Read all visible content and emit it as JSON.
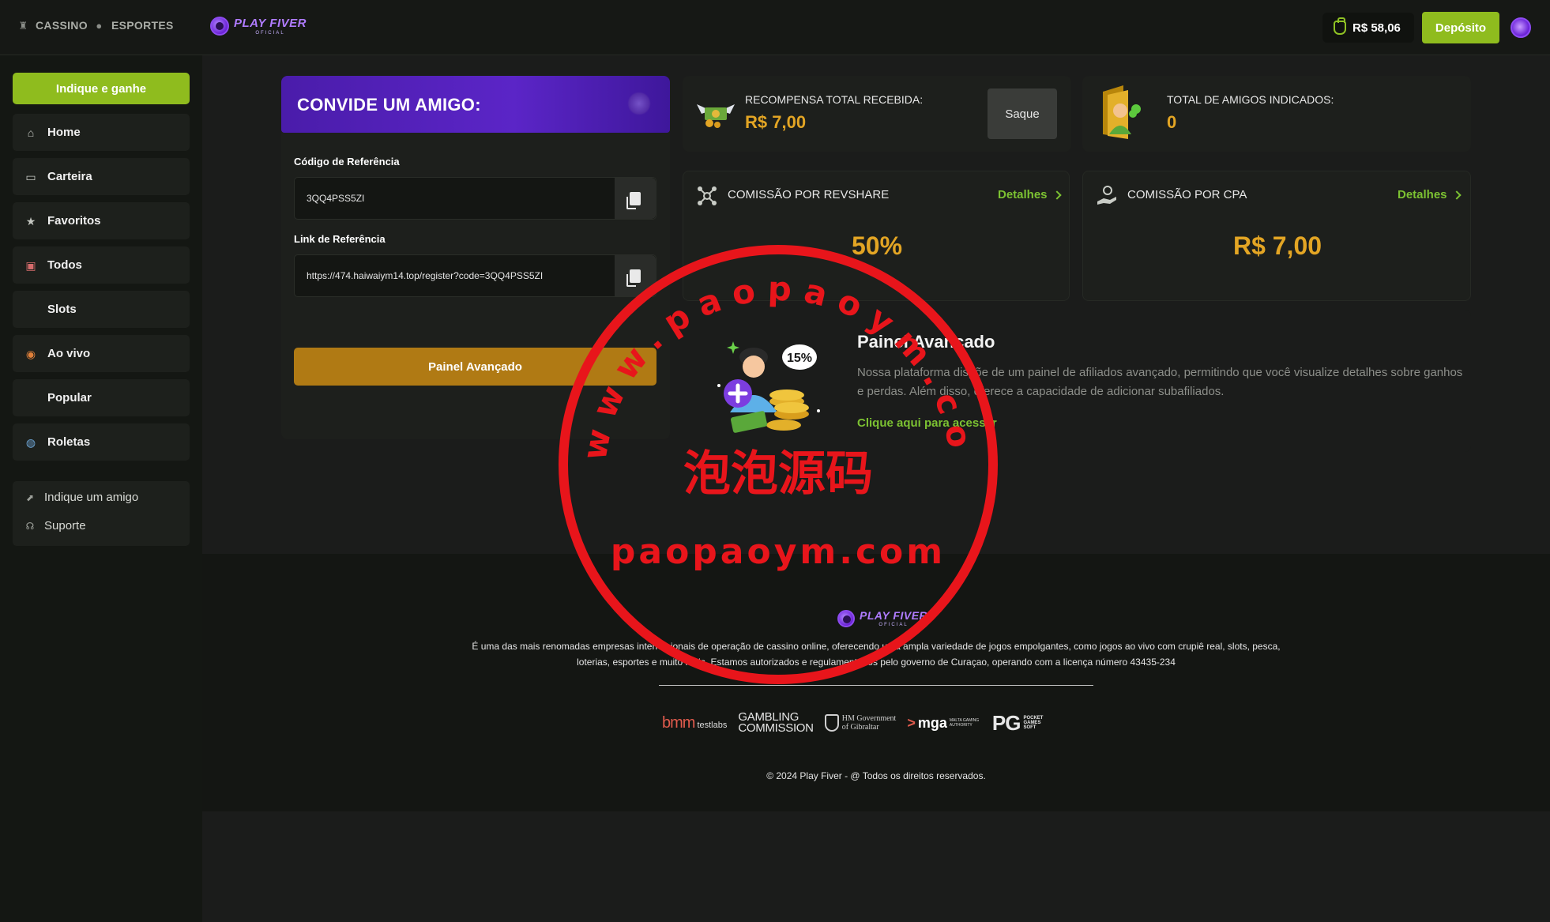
{
  "header": {
    "categories": [
      {
        "label": "CASSINO",
        "icon": "casino-icon"
      },
      {
        "label": "ESPORTES",
        "icon": "sports-ball-icon"
      }
    ],
    "logo": {
      "name": "PLAY FIVER",
      "tagline": "OFICIAL"
    },
    "balance": "R$ 58,06",
    "deposit_label": "Depósito"
  },
  "sidebar": {
    "cta_label": "Indique e ganhe",
    "items": [
      {
        "label": "Home",
        "icon": "home-icon"
      },
      {
        "label": "Carteira",
        "icon": "wallet-icon"
      },
      {
        "label": "Favoritos",
        "icon": "star-icon"
      },
      {
        "label": "Todos",
        "icon": "cake-icon"
      },
      {
        "label": "Slots",
        "icon": ""
      },
      {
        "label": "Ao vivo",
        "icon": "live-icon"
      },
      {
        "label": "Popular",
        "icon": ""
      },
      {
        "label": "Roletas",
        "icon": "roulette-icon"
      }
    ],
    "links": [
      {
        "label": "Indique um amigo",
        "icon": "share-icon"
      },
      {
        "label": "Suporte",
        "icon": "headset-icon"
      }
    ]
  },
  "invite": {
    "title": "CONVIDE UM AMIGO:",
    "code_label": "Código de Referência",
    "code_value": "3QQ4PSS5ZI",
    "link_label": "Link de Referência",
    "link_value": "https://474.haiwaiym14.top/register?code=3QQ4PSS5ZI",
    "advanced_button": "Painel Avançado"
  },
  "rewards": {
    "total_label": "RECOMPENSA TOTAL RECEBIDA:",
    "total_value": "R$ 7,00",
    "saque_label": "Saque",
    "friends_label": "TOTAL DE AMIGOS INDICADOS:",
    "friends_value": "0"
  },
  "commissions": {
    "revshare_label": "COMISSÃO POR REVSHARE",
    "revshare_value": "50%",
    "cpa_label": "COMISSÃO POR CPA",
    "cpa_value": "R$ 7,00",
    "details_label": "Detalhes"
  },
  "advanced_panel": {
    "title": "Painel Avançado",
    "description": "Nossa plataforma dispõe de um painel de afiliados avançado, permitindo que você visualize detalhes sobre ganhos e perdas. Além disso, oferece a capacidade de adicionar subafiliados.",
    "link": "Clique aqui para acessar",
    "badge": "15%"
  },
  "footer": {
    "logo_name": "PLAY FIVER",
    "logo_tagline": "OFICIAL",
    "description": "É uma das mais renomadas empresas internacionais de operação de cassino online, oferecendo uma ampla variedade de jogos empolgantes, como jogos ao vivo com crupiê real, slots, pesca, loterias, esportes e muito mais. Estamos autorizados e regulamentados pelo governo de Curaçao, operando com a licença número 43435-234",
    "partners": {
      "bmm": "bmm",
      "bmm_sub": "testlabs",
      "gc1": "GAMBLING",
      "gc2": "COMMISSION",
      "gib1": "HM Government",
      "gib2": "of Gibraltar",
      "mga": "mga",
      "mga_sub": "MALTA GAMING AUTHORITY",
      "pg": "PG",
      "pg_sub": "POCKET GAMES SOFT"
    },
    "copyright": "© 2024 Play Fiver - @ Todos os direitos reservados."
  },
  "watermark": {
    "arc_text": "www.paopaoym.com",
    "center_text": "泡泡源码",
    "bottom_text": "paopaoym.com"
  },
  "colors": {
    "accent_green": "#8fbc1e",
    "gold": "#e3a524",
    "purple": "#5b25c7",
    "link_green": "#7cc232",
    "watermark_red": "#e8151b"
  }
}
